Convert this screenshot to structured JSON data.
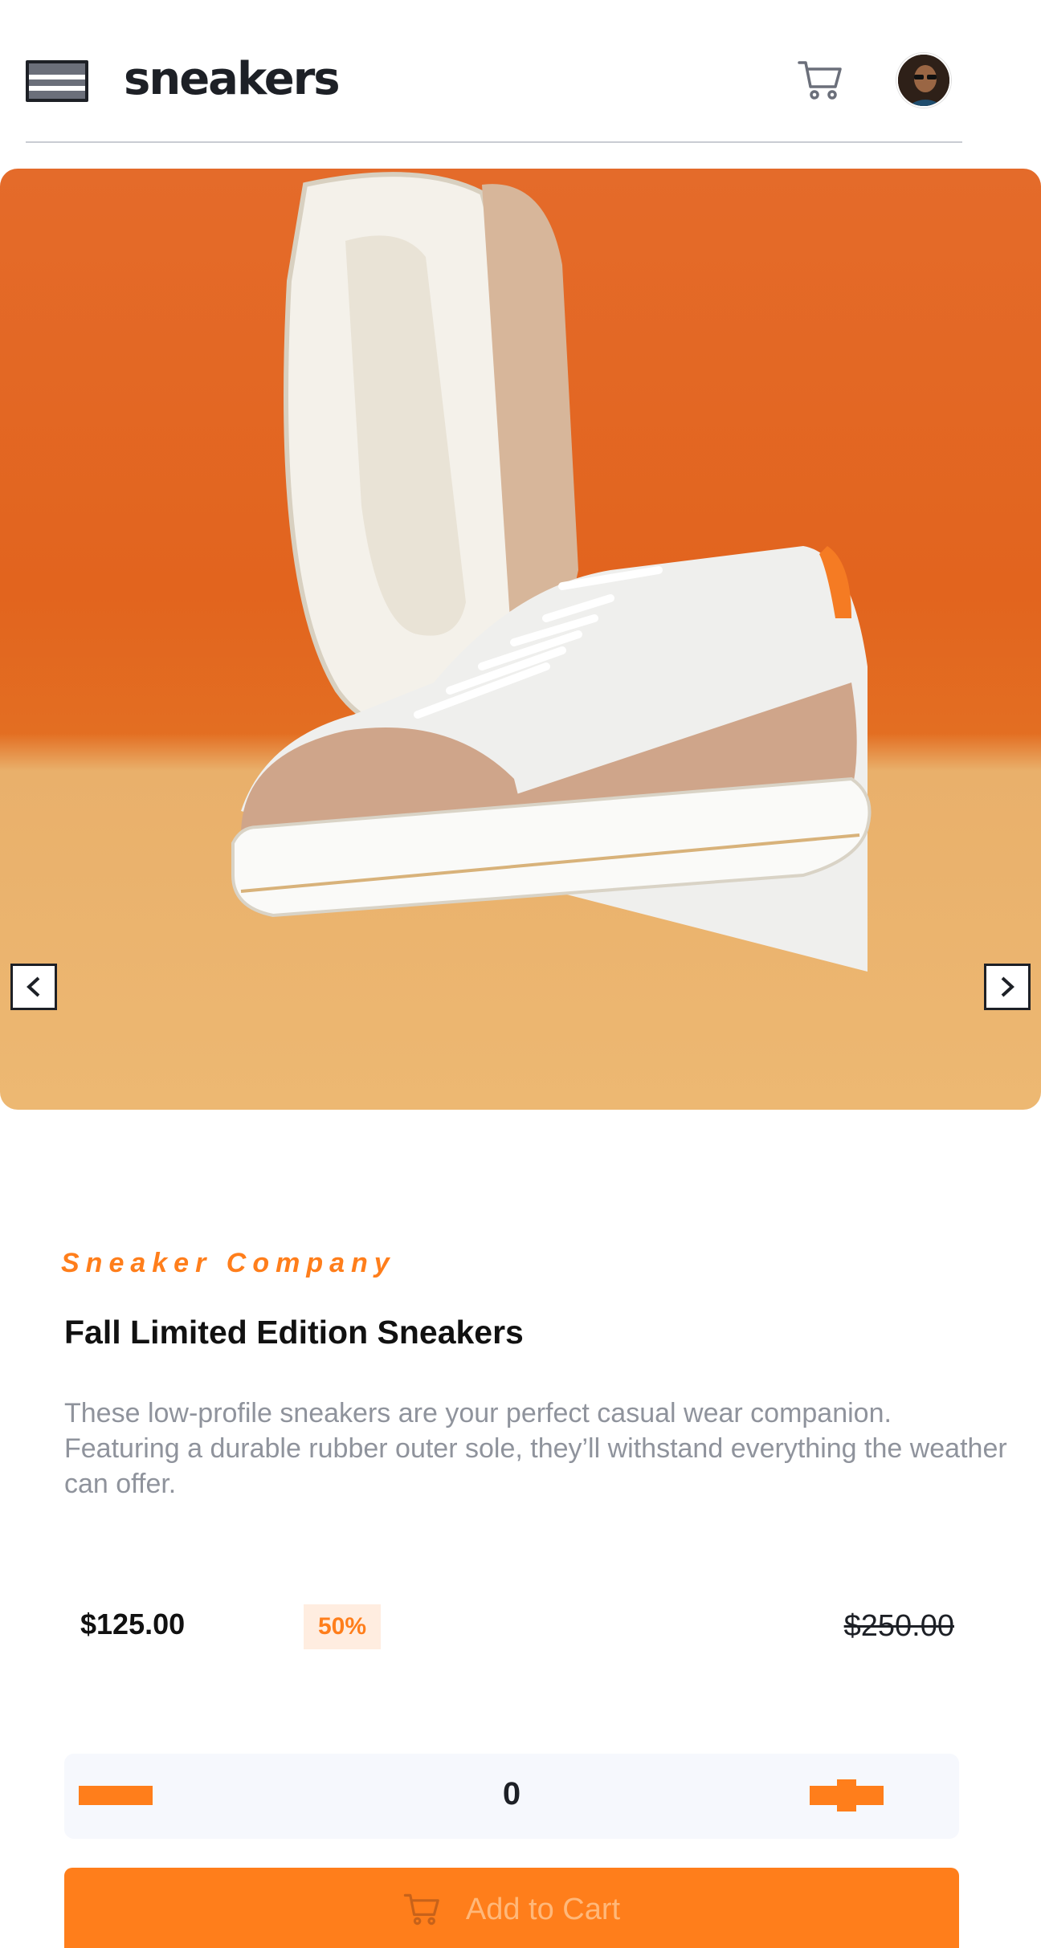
{
  "header": {
    "logo": "sneakers",
    "icons": {
      "menu": "menu-icon",
      "cart": "cart-icon",
      "avatar": "user-avatar"
    }
  },
  "gallery": {
    "prev_icon": "chevron-left-icon",
    "next_icon": "chevron-right-icon"
  },
  "product": {
    "company": "Sneaker Company",
    "title": "Fall Limited Edition Sneakers",
    "description": "These low-profile sneakers are your perfect casual wear companion. Featuring a durable rubber outer sole, they’ll withstand everything the weather can offer.",
    "price": "$125.00",
    "discount": "50%",
    "original_price": "$250.00"
  },
  "quantity": {
    "value": "0",
    "minus_icon": "minus-icon",
    "plus_icon": "plus-icon"
  },
  "add_to_cart": {
    "label": "Add to Cart",
    "icon": "cart-icon"
  },
  "colors": {
    "accent": "#ff7e1b",
    "accent_pale": "#ffede0",
    "dark": "#1d2026",
    "muted_text": "#8f939c",
    "qty_bg": "#f6f8fd",
    "gallery_orange": "#e2641e",
    "gallery_floor": "#edb872"
  }
}
